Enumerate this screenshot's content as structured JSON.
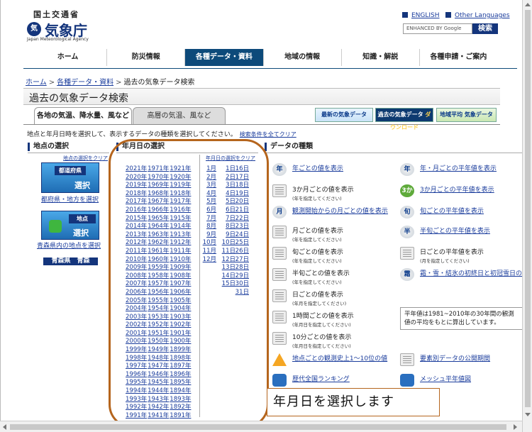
{
  "header": {
    "ministry": "国土交通省",
    "agency": "気象庁",
    "agency_en": "Japan Meteorological Agency",
    "english": "ENGLISH",
    "other_languages": "Other Languages",
    "search_placeholder": "ENHANCED BY Google",
    "search_button": "検索"
  },
  "nav": [
    "ホーム",
    "防災情報",
    "各種データ・資料",
    "地域の情報",
    "知識・解説",
    "各種申請・ご案内"
  ],
  "breadcrumb": [
    "ホーム",
    "各種データ・資料",
    "過去の気象データ検索"
  ],
  "page_title": "過去の気象データ検索",
  "tabs": [
    "各地の気温、降水量、風など",
    "高層の気温、風など"
  ],
  "banners": {
    "latest": "最新の気象データ",
    "download_top": "過去の気象データ",
    "download": "ダウンロード",
    "normals": "地域平均 気象データ"
  },
  "instruction": "地点と年月日時を選択して、表示するデータの種類を選択してください。",
  "clear_all": "検索条件を全てクリア",
  "location": {
    "heading": "地点の選択",
    "clear": "地点の選択をクリア",
    "pref_icon_label": "都道府県",
    "select": "選択",
    "pref_link": "都府県・地方を選択",
    "point_icon_label": "地点",
    "point_link": "青森県内の地点を選択",
    "current": "青森県　青森"
  },
  "date": {
    "heading": "年月日の選択",
    "clear": "年月日の選択をクリア",
    "years": [
      [
        "2021年",
        "1971年",
        "1921年"
      ],
      [
        "2020年",
        "1970年",
        "1920年"
      ],
      [
        "2019年",
        "1969年",
        "1919年"
      ],
      [
        "2018年",
        "1968年",
        "1918年"
      ],
      [
        "2017年",
        "1967年",
        "1917年"
      ],
      [
        "2016年",
        "1966年",
        "1916年"
      ],
      [
        "2015年",
        "1965年",
        "1915年"
      ],
      [
        "2014年",
        "1964年",
        "1914年"
      ],
      [
        "2013年",
        "1963年",
        "1913年"
      ],
      [
        "2012年",
        "1962年",
        "1912年"
      ],
      [
        "2011年",
        "1961年",
        "1911年"
      ],
      [
        "2010年",
        "1960年",
        "1910年"
      ],
      [
        "2009年",
        "1959年",
        "1909年"
      ],
      [
        "2008年",
        "1958年",
        "1908年"
      ],
      [
        "2007年",
        "1957年",
        "1907年"
      ],
      [
        "2006年",
        "1956年",
        "1906年"
      ],
      [
        "2005年",
        "1955年",
        "1905年"
      ],
      [
        "2004年",
        "1954年",
        "1904年"
      ],
      [
        "2003年",
        "1953年",
        "1903年"
      ],
      [
        "2002年",
        "1952年",
        "1902年"
      ],
      [
        "2001年",
        "1951年",
        "1901年"
      ],
      [
        "2000年",
        "1950年",
        "1900年"
      ],
      [
        "1999年",
        "1949年",
        "1899年"
      ],
      [
        "1998年",
        "1948年",
        "1898年"
      ],
      [
        "1997年",
        "1947年",
        "1897年"
      ],
      [
        "1996年",
        "1946年",
        "1896年"
      ],
      [
        "1995年",
        "1945年",
        "1895年"
      ],
      [
        "1994年",
        "1944年",
        "1894年"
      ],
      [
        "1993年",
        "1943年",
        "1893年"
      ],
      [
        "1992年",
        "1942年",
        "1892年"
      ],
      [
        "1991年",
        "1941年",
        "1891年"
      ]
    ],
    "months": [
      "1月",
      "2月",
      "3月",
      "4月",
      "5月",
      "6月",
      "7月",
      "8月",
      "9月",
      "10月",
      "11月",
      "12月"
    ],
    "days_left": [
      "1日",
      "2日",
      "3日",
      "4日",
      "5日",
      "6日",
      "7日",
      "8日",
      "9日",
      "10日",
      "11日",
      "12日",
      "13日",
      "14日",
      "15日"
    ],
    "days_right": [
      "16日",
      "17日",
      "18日",
      "19日",
      "20日",
      "21日",
      "22日",
      "23日",
      "24日",
      "25日",
      "26日",
      "27日",
      "28日",
      "29日",
      "30日",
      "31日"
    ]
  },
  "datatype": {
    "heading": "データの種類",
    "left": [
      {
        "icon": "年",
        "style": "round",
        "main": "年ごとの値を表示",
        "sub": "",
        "link": true
      },
      {
        "icon": "",
        "style": "grid",
        "main": "3か月ごとの値を表示",
        "sub": "(年を指定してください)",
        "link": false
      },
      {
        "icon": "月",
        "style": "round",
        "main": "観測開始からの月ごとの値を表示",
        "sub": "",
        "link": true
      },
      {
        "icon": "",
        "style": "grid",
        "main": "月ごとの値を表示",
        "sub": "(年を指定してください)",
        "link": false
      },
      {
        "icon": "",
        "style": "grid",
        "main": "旬ごとの値を表示",
        "sub": "(年を指定してください)",
        "link": false
      },
      {
        "icon": "",
        "style": "grid",
        "main": "半旬ごとの値を表示",
        "sub": "(年を指定してください)",
        "link": false
      },
      {
        "icon": "",
        "style": "grid",
        "main": "日ごとの値を表示",
        "sub": "(年月を指定してください)",
        "link": false
      },
      {
        "icon": "",
        "style": "grid",
        "main": "1時間ごとの値を表示",
        "sub": "(年月日を指定してください)",
        "link": false
      },
      {
        "icon": "",
        "style": "grid",
        "main": "10分ごとの値を表示",
        "sub": "(年月日を指定してください)",
        "link": false
      },
      {
        "icon": "",
        "style": "tri",
        "main": "地点ごとの観測史上1～10位の値",
        "sub": "",
        "link": true
      },
      {
        "icon": "",
        "style": "book",
        "main": "歴代全国ランキング",
        "sub": "",
        "link": true
      }
    ],
    "right": [
      {
        "icon": "年",
        "style": "round",
        "main": "年・月ごとの平年値を表示",
        "sub": "",
        "link": true
      },
      {
        "icon": "3か",
        "style": "green",
        "main": "3か月ごとの平年値を表示",
        "sub": "",
        "link": true
      },
      {
        "icon": "旬",
        "style": "round",
        "main": "旬ごとの平年値を表示",
        "sub": "",
        "link": true
      },
      {
        "icon": "半",
        "style": "round",
        "main": "半旬ごとの平年値を表示",
        "sub": "",
        "link": true
      },
      {
        "icon": "",
        "style": "grid",
        "main": "日ごとの平年値を表示",
        "sub": "(月を指定してください)",
        "link": false
      },
      {
        "icon": "",
        "style": "grid",
        "main": "日ごとの平年値を表示",
        "sub": "(月を指定してください)",
        "link": false
      },
      {
        "icon": "霜",
        "style": "round",
        "main": "霜・雪・結氷の初終日と初冠雪日の",
        "sub": "",
        "link": true
      },
      {
        "icon": "",
        "style": "grid",
        "main": "要素別データの公開期間",
        "sub": "",
        "link": true
      },
      {
        "icon": "",
        "style": "book",
        "main": "メッシュ平年値図",
        "sub": "",
        "link": true
      }
    ],
    "note": "平年値は1981~2010年の30年間の観測値の平均をもとに算出しています。"
  },
  "callout": "年月日を選択します",
  "colors": {
    "brand": "#14357c",
    "nav_active": "#0d4a7a",
    "link": "#1a3c9c",
    "annotation": "#b5651d"
  }
}
